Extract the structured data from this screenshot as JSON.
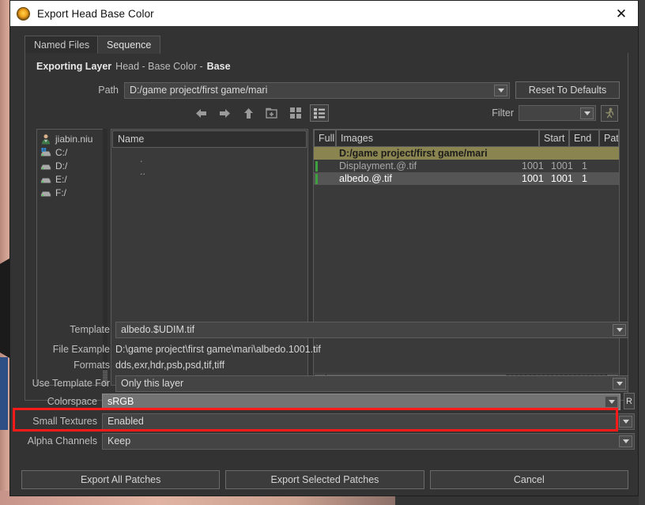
{
  "window": {
    "title": "Export Head Base Color",
    "app_icon": "mari-app-icon",
    "close_label": "✕"
  },
  "tabs": [
    {
      "id": "named-files",
      "label": "Named Files",
      "active": false
    },
    {
      "id": "sequence",
      "label": "Sequence",
      "active": true
    }
  ],
  "exporting": {
    "label": "Exporting Layer",
    "value": "Head - Base Color - ",
    "value_bold": "Base"
  },
  "path": {
    "label": "Path",
    "value": "D:/game project/first game/mari",
    "reset_label": "Reset To Defaults"
  },
  "navbar": {
    "icons": [
      {
        "name": "back-icon",
        "glyph": "←"
      },
      {
        "name": "forward-icon",
        "glyph": "→"
      },
      {
        "name": "up-icon",
        "glyph": "↑"
      },
      {
        "name": "new-folder-icon",
        "glyph": "⊞"
      },
      {
        "name": "grid-view-icon",
        "glyph": "▦"
      },
      {
        "name": "list-view-icon",
        "glyph": "≣"
      }
    ]
  },
  "filter": {
    "label": "Filter",
    "value": "",
    "run_icon": "run-person-icon"
  },
  "places": [
    {
      "icon": "user-icon",
      "label": "jiabin.niu"
    },
    {
      "icon": "windows-drive-icon",
      "label": "C:/"
    },
    {
      "icon": "drive-icon",
      "label": "D:/"
    },
    {
      "icon": "drive-icon",
      "label": "E:/"
    },
    {
      "icon": "drive-icon",
      "label": "F:/"
    }
  ],
  "file_list": {
    "column_header": "Name",
    "sort": "ascending",
    "rows": [
      ".",
      ".."
    ]
  },
  "images_table": {
    "columns": [
      "Full",
      "Images",
      "Start",
      "End",
      "Patch Coun"
    ],
    "group_row": "D:/game project/first game/mari",
    "rows": [
      {
        "name": "Displayment.@.tif",
        "start": "1001",
        "end": "1001",
        "patch_count": "1",
        "selected": false
      },
      {
        "name": "albedo.@.tif",
        "start": "1001",
        "end": "1001",
        "patch_count": "1",
        "selected": true
      }
    ]
  },
  "form": {
    "template": {
      "label": "Template",
      "value": "albedo.$UDIM.tif"
    },
    "file_example": {
      "label": "File Example",
      "value": "D:\\game project\\first game\\mari\\albedo.1001.tif"
    },
    "formats": {
      "label": "Formats",
      "value": "dds,exr,hdr,psb,psd,tif,tiff"
    },
    "use_template_for": {
      "label": "Use Template For",
      "value": "Only this layer"
    },
    "colorspace": {
      "label": "Colorspace",
      "value": "sRGB",
      "side_button": "R"
    },
    "small_textures": {
      "label": "Small Textures",
      "value": "Enabled"
    },
    "alpha_channels": {
      "label": "Alpha Channels",
      "value": "Keep"
    }
  },
  "footer": {
    "export_all": "Export All Patches",
    "export_selected": "Export Selected Patches",
    "cancel": "Cancel"
  },
  "colors": {
    "highlight_box": "#ff1a1a",
    "group_row": "#8a8450",
    "selected_row": "#555555",
    "titlebar": "#ffffff",
    "dialog_bg": "#333333"
  }
}
